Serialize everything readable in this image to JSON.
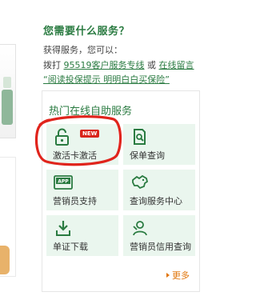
{
  "service": {
    "title": "您需要什么服务？",
    "subtitle": "获得服务，您可以：",
    "line_prefix": "拨打",
    "hotline": "95519客户服务专线",
    "line_or": "或",
    "message_link": "在线留言",
    "promo_link": "“阅读投保提示 明明白白买保险”"
  },
  "panel": {
    "title": "热门在线自助服务",
    "tiles": [
      {
        "label": "激活卡激活",
        "badge": "NEW",
        "icon": "unlock-icon"
      },
      {
        "label": "保单查询",
        "icon": "document-search-icon"
      },
      {
        "label": "营销员支持",
        "icon": "app-icon"
      },
      {
        "label": "查询服务中心",
        "icon": "china-map-icon"
      },
      {
        "label": "单证下载",
        "icon": "download-icon"
      },
      {
        "label": "营销员信用查询",
        "icon": "credit-search-icon"
      }
    ],
    "more": "更多"
  },
  "colors": {
    "brand_green": "#2a7b41",
    "tile_bg": "#eaf6ee",
    "badge_red": "#d9241b",
    "more_orange": "#e1750a",
    "annotation_red": "#e0241c"
  }
}
